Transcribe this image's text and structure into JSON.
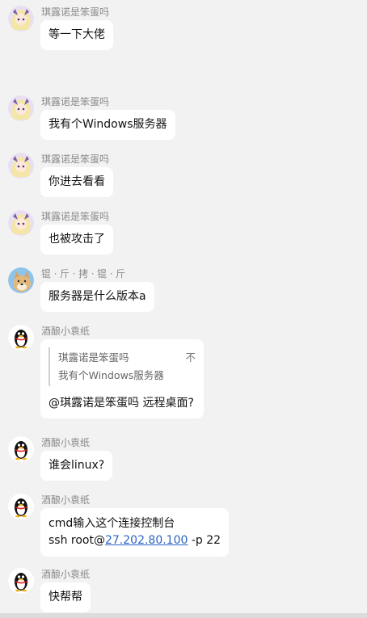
{
  "messages": [
    {
      "name": "琪露诺是笨蛋吗",
      "text": "等一下大佬"
    },
    {
      "name": "琪露诺是笨蛋吗",
      "text": "我有个Windows服务器"
    },
    {
      "name": "琪露诺是笨蛋吗",
      "text": "你进去看看"
    },
    {
      "name": "琪露诺是笨蛋吗",
      "text": "也被攻击了"
    },
    {
      "name": "锟ㆍ斤ㆍ拷ㆍ锟ㆍ斤",
      "text": "服务器是什么版本a"
    },
    {
      "name": "酒酿小袁纸",
      "quote": {
        "author": "琪露诺是笨蛋吗",
        "text": "我有个Windows服务器",
        "close": "不"
      },
      "text": "@琪露诺是笨蛋吗  远程桌面?"
    },
    {
      "name": "酒酿小袁纸",
      "text": "谁会linux?"
    },
    {
      "name": "酒酿小袁纸",
      "line1": "cmd输入这个连接控制台",
      "line2_prefix": "ssh root@",
      "line2_link": "27.202.80.100",
      "line2_suffix": " -p 22"
    },
    {
      "name": "酒酿小袁纸",
      "text": "快帮帮"
    }
  ],
  "colors": {
    "anime_avatar": "#d9c4e8",
    "dog_avatar": "#8fc3ea",
    "qq_avatar": "#ffffff"
  },
  "icons": {
    "anime": "anime-girl-avatar",
    "dog": "shiba-dog-avatar",
    "qq": "qq-penguin-avatar"
  }
}
